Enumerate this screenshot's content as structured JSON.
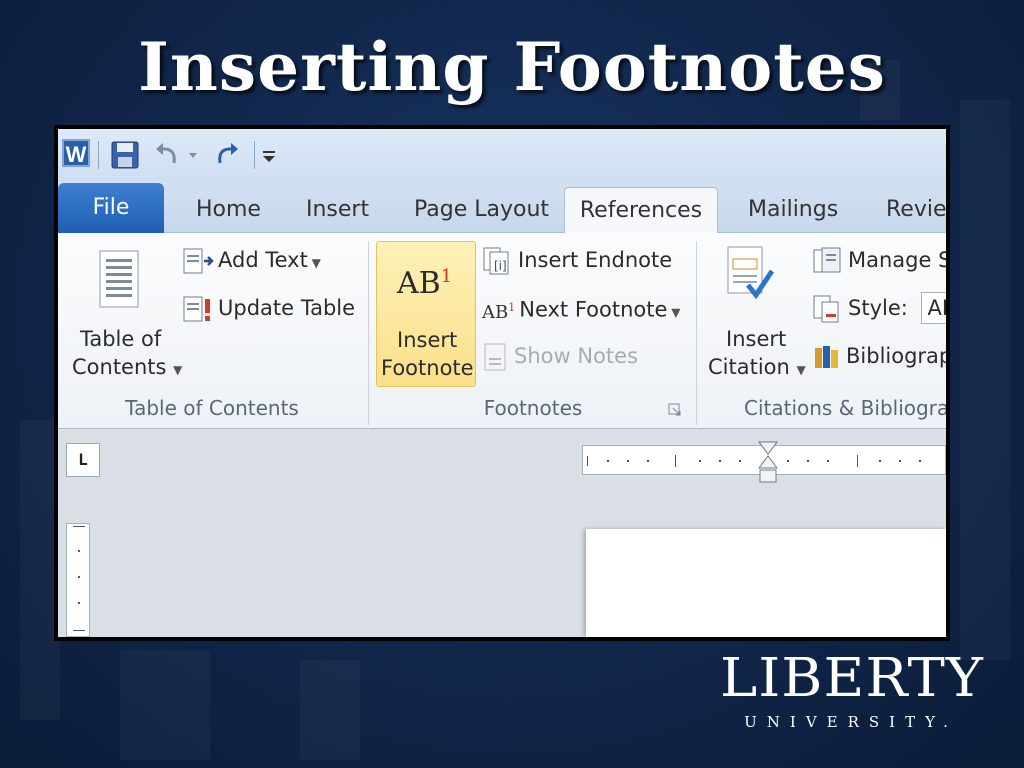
{
  "slide": {
    "title": "Inserting Footnotes"
  },
  "app": {
    "tabs": [
      "File",
      "Home",
      "Insert",
      "Page Layout",
      "References",
      "Mailings",
      "Review"
    ],
    "active_tab": "References",
    "groups": {
      "toc": {
        "label": "Table of Contents",
        "toc_button_line1": "Table of",
        "toc_button_line2": "Contents",
        "add_text": "Add Text",
        "update_table": "Update Table"
      },
      "footnotes": {
        "label": "Footnotes",
        "insert_footnote_icon_text": "AB",
        "insert_footnote_icon_sup": "1",
        "insert_footnote_line1": "Insert",
        "insert_footnote_line2": "Footnote",
        "insert_endnote": "Insert Endnote",
        "next_footnote_icon_text": "AB",
        "next_footnote_icon_sup": "1",
        "next_footnote": "Next Footnote",
        "show_notes": "Show Notes"
      },
      "citations": {
        "label": "Citations & Bibliogra",
        "insert_citation_line1": "Insert",
        "insert_citation_line2": "Citation",
        "manage_sources": "Manage S",
        "style_label": "Style:",
        "style_value": "APA",
        "bibliography": "Bibliograp"
      }
    },
    "ruler_tab_symbol": "L"
  },
  "logo": {
    "main": "LIBERTY",
    "sub": "UNIVERSITY."
  },
  "colors": {
    "slide_bg": "#10264a",
    "file_tab": "#2b67bd",
    "footnote_highlight": "#fbe08a"
  }
}
